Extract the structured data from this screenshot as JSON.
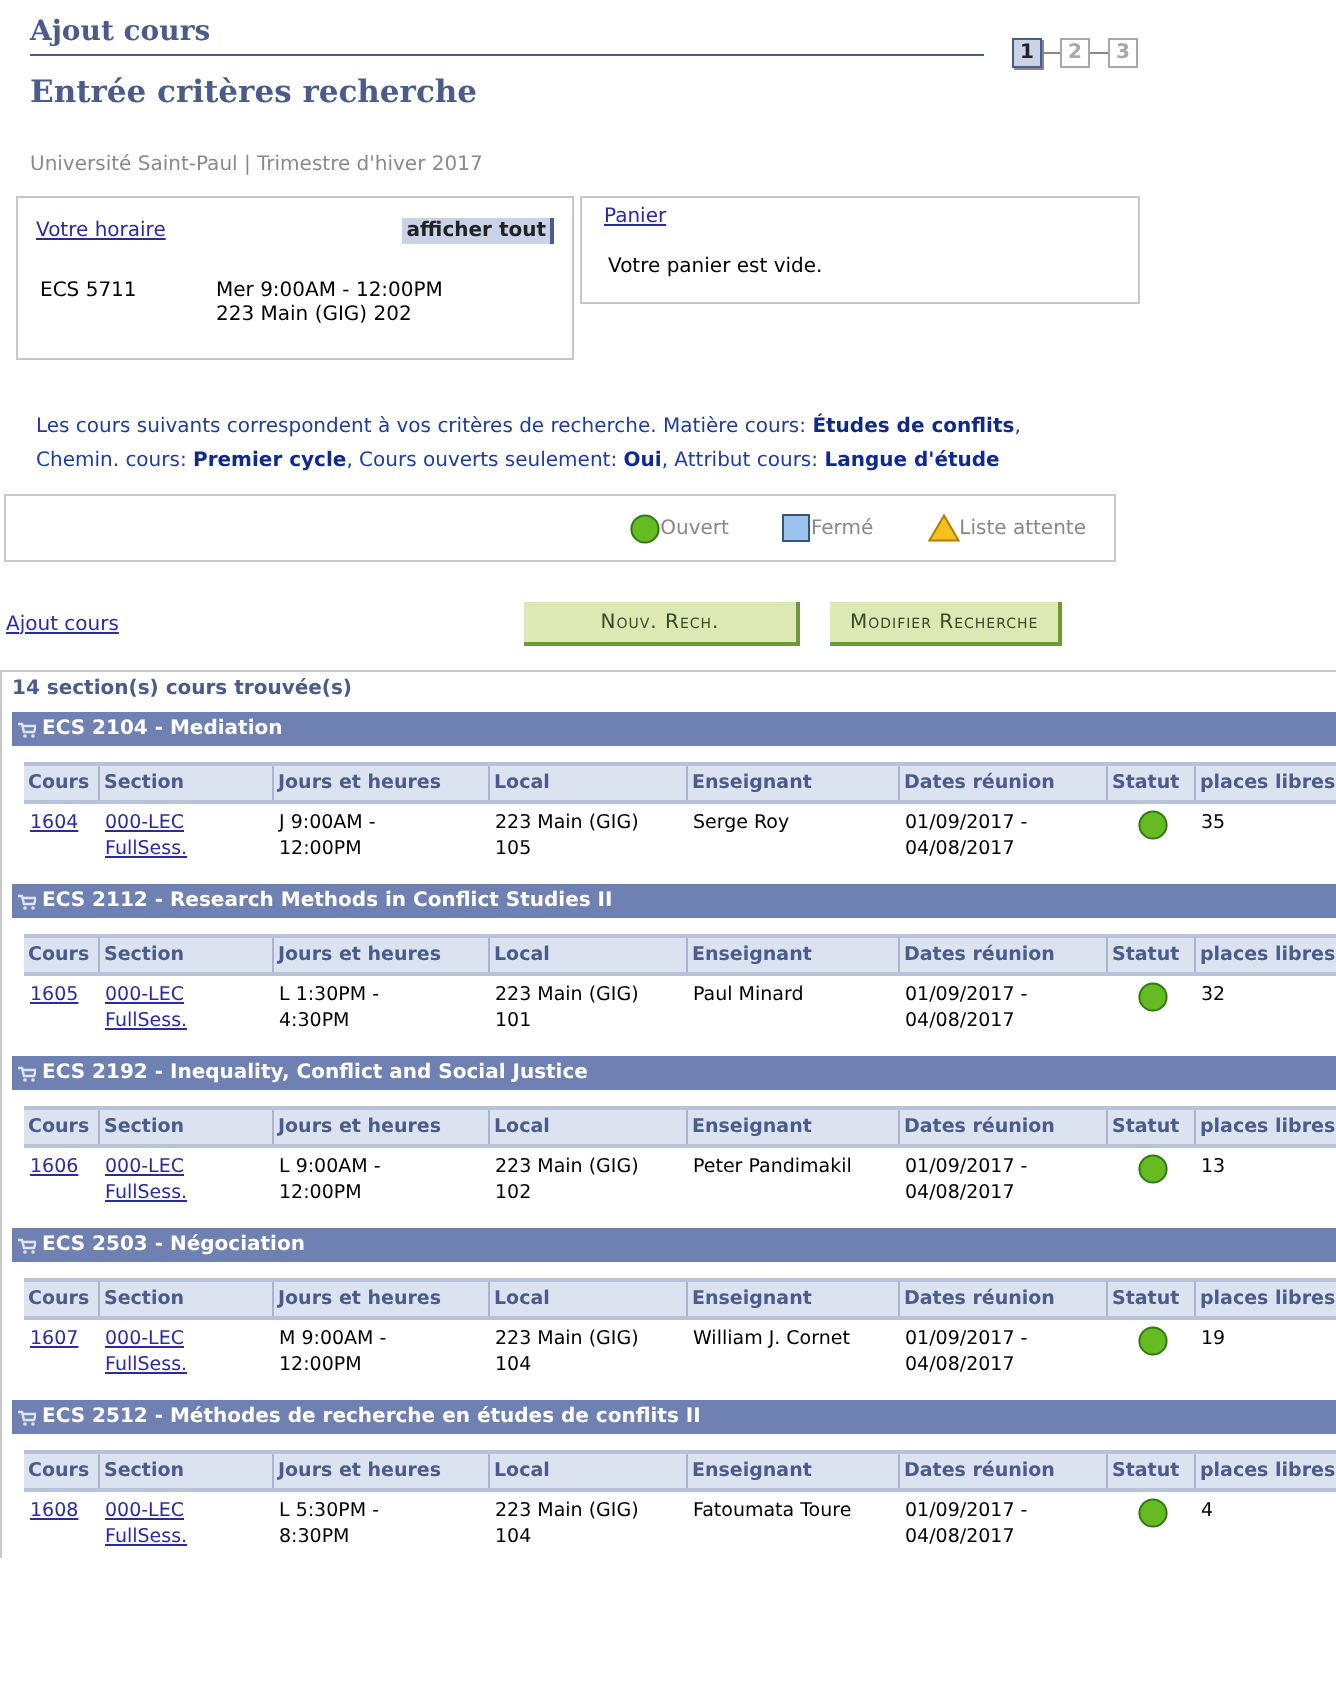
{
  "page": {
    "title": "Ajout cours",
    "subtitle": "Entrée critères recherche",
    "institution": "Université Saint-Paul | Trimestre d'hiver 2017"
  },
  "steps": [
    {
      "label": "1",
      "selected": true
    },
    {
      "label": "2",
      "selected": false
    },
    {
      "label": "3",
      "selected": false
    }
  ],
  "schedule": {
    "link": "Votre horaire",
    "button": "afficher tout",
    "entries": [
      {
        "course": "ECS 5711",
        "time": "Mer 9:00AM - 12:00PM",
        "room": "223 Main (GIG) 202"
      }
    ]
  },
  "cart": {
    "link": "Panier",
    "message": "Votre panier est vide."
  },
  "criteria": "Les cours suivants correspondent à vos critères de recherche. Matière cours: **Études de conflits**,  Chemin. cours: **Premier cycle**,  Cours ouverts seulement: **Oui**,  Attribut cours: **Langue d'étude**",
  "legend": [
    {
      "kind": "open",
      "label": "Ouvert"
    },
    {
      "kind": "closed",
      "label": "Fermé"
    },
    {
      "kind": "waitlist",
      "label": "Liste attente"
    }
  ],
  "add_link": "Ajout cours",
  "buttons": [
    "Nouv. Rech.",
    "Modifier Recherche"
  ],
  "results_count": "14 section(s) cours trouvée(s)",
  "groups": [
    {
      "title": "ECS 2104 - Mediation",
      "columns": [
        "Cours",
        "Section",
        "Jours et heures",
        "Local",
        "Enseignant",
        "Dates réunion",
        "Statut",
        "places libres"
      ],
      "rows": [
        {
          "class": "1604",
          "section": "000-LEC",
          "session": "FullSess.",
          "days": "J 9:00AM -",
          "hours": "12:00PM",
          "room": "223 Main (GIG)",
          "room_no": "105",
          "instructor": "Serge Roy",
          "start": "01/09/2017 -",
          "end": "04/08/2017",
          "kind": "open",
          "seats": "35"
        }
      ]
    },
    {
      "title": "ECS 2112 - Research Methods in Conflict Studies II",
      "columns": [
        "Cours",
        "Section",
        "Jours et heures",
        "Local",
        "Enseignant",
        "Dates réunion",
        "Statut",
        "places libres"
      ],
      "rows": [
        {
          "class": "1605",
          "section": "000-LEC",
          "session": "FullSess.",
          "days": "L 1:30PM -",
          "hours": "4:30PM",
          "room": "223 Main (GIG)",
          "room_no": "101",
          "instructor": "Paul Minard",
          "start": "01/09/2017 -",
          "end": "04/08/2017",
          "kind": "open",
          "seats": "32"
        }
      ]
    },
    {
      "title": "ECS 2192 - Inequality, Conflict and Social Justice",
      "columns": [
        "Cours",
        "Section",
        "Jours et heures",
        "Local",
        "Enseignant",
        "Dates réunion",
        "Statut",
        "places libres"
      ],
      "rows": [
        {
          "class": "1606",
          "section": "000-LEC",
          "session": "FullSess.",
          "days": "L 9:00AM -",
          "hours": "12:00PM",
          "room": "223 Main (GIG)",
          "room_no": "102",
          "instructor": "Peter Pandimakil",
          "start": "01/09/2017 -",
          "end": "04/08/2017",
          "kind": "open",
          "seats": "13"
        }
      ]
    },
    {
      "title": "ECS 2503 - Négociation",
      "columns": [
        "Cours",
        "Section",
        "Jours et heures",
        "Local",
        "Enseignant",
        "Dates réunion",
        "Statut",
        "places libres"
      ],
      "rows": [
        {
          "class": "1607",
          "section": "000-LEC",
          "session": "FullSess.",
          "days": "M 9:00AM -",
          "hours": "12:00PM",
          "room": "223 Main (GIG)",
          "room_no": "104",
          "instructor": "William J. Cornet",
          "start": "01/09/2017 -",
          "end": "04/08/2017",
          "kind": "open",
          "seats": "19"
        }
      ]
    },
    {
      "title": "ECS 2512 - Méthodes de recherche en études de conflits II",
      "columns": [
        "Cours",
        "Section",
        "Jours et heures",
        "Local",
        "Enseignant",
        "Dates réunion",
        "Statut",
        "places libres"
      ],
      "rows": [
        {
          "class": "1608",
          "section": "000-LEC",
          "session": "FullSess.",
          "days": "L 5:30PM -",
          "hours": "8:30PM",
          "room": "223 Main (GIG)",
          "room_no": "104",
          "instructor": "Fatoumata Toure",
          "start": "01/09/2017 -",
          "end": "04/08/2017",
          "kind": "open",
          "seats": "4"
        }
      ]
    }
  ]
}
